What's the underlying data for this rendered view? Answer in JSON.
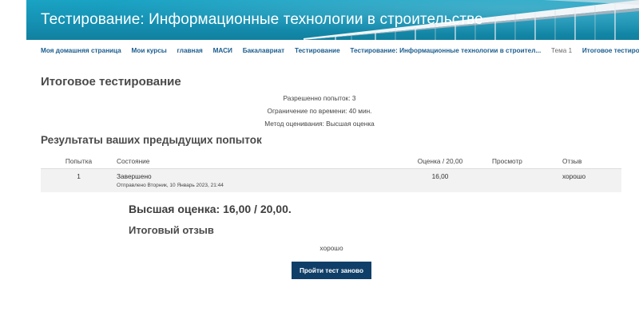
{
  "header": {
    "course_title": "Тестирование: Информационные технологии в строительстве"
  },
  "breadcrumb": {
    "items": [
      "Моя домашняя страница",
      "Мои курсы",
      "главная",
      "МАСИ",
      "Бакалавриат",
      "Тестирование",
      "Тестирование: Информационные технологии в строител..."
    ],
    "current": "Тема 1",
    "last": "Итоговое тестирование"
  },
  "quiz": {
    "title": "Итоговое тестирование",
    "attempts_allowed": "Разрешенно попыток: 3",
    "time_limit": "Ограничение по времени: 40 мин.",
    "grading_method": "Метод оценивания: Высшая оценка"
  },
  "results": {
    "title": "Результаты ваших предыдущих попыток",
    "columns": [
      "Попытка",
      "Состояние",
      "Оценка / 20,00",
      "Просмотр",
      "Отзыв"
    ],
    "rows": [
      {
        "attempt": "1",
        "state": "Завершено",
        "submitted": "Отправлено Вторник, 10 Январь 2023, 21:44",
        "grade": "16,00",
        "review": "",
        "feedback": "хорошо"
      }
    ]
  },
  "summary": {
    "highest_grade": "Высшая оценка: 16,00 / 20,00.",
    "feedback_title": "Итоговый отзыв",
    "feedback_text": "хорошо"
  },
  "actions": {
    "retry_label": "Пройти тест заново"
  },
  "colors": {
    "banner": "#1591b3",
    "link": "#1a5d8f",
    "button": "#0f3f68"
  }
}
